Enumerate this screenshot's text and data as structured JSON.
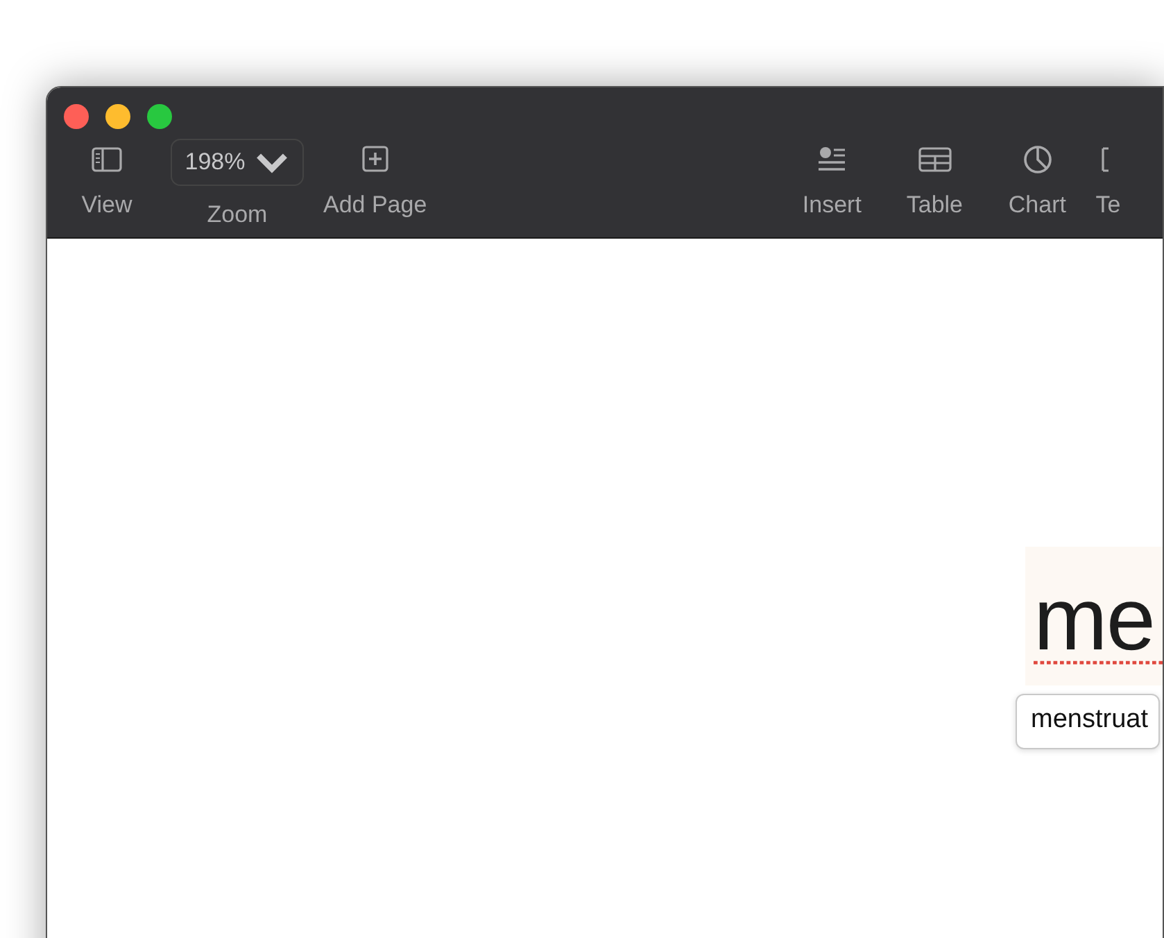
{
  "toolbar": {
    "left": [
      {
        "kind": "sidebar",
        "label": "View"
      },
      {
        "kind": "zoom",
        "label": "Zoom",
        "value": "198%"
      },
      {
        "kind": "addpage",
        "label": "Add Page"
      }
    ],
    "right": [
      {
        "kind": "insert",
        "label": "Insert"
      },
      {
        "kind": "table",
        "label": "Table"
      },
      {
        "kind": "chart",
        "label": "Chart"
      },
      {
        "kind": "textbox",
        "label": "Te"
      }
    ]
  },
  "document": {
    "word": "me",
    "misspelled": true,
    "suggestion": "menstruat"
  }
}
